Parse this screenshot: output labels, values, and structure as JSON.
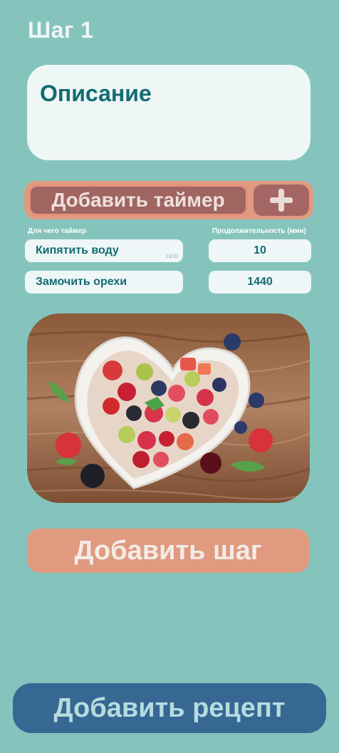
{
  "step": {
    "title": "Шаг 1"
  },
  "description": {
    "label": "Описание"
  },
  "timer": {
    "add_label": "Добавить таймер",
    "plus_icon": "plus-icon",
    "purpose_header": "Для чего таймер",
    "duration_header": "Продолжительность (мин)",
    "rows": [
      {
        "purpose": "Кипятить воду",
        "char_counter": "13/20",
        "duration": "10"
      },
      {
        "purpose": "Замочить орехи",
        "duration": "1440"
      }
    ]
  },
  "photo": {
    "subject": "fruit-and-berry-salad-in-heart-shaped-bowl"
  },
  "actions": {
    "add_step_label": "Добавить шаг",
    "add_recipe_label": "Добавить рецепт"
  },
  "colors": {
    "background": "#85c4bd",
    "card": "#eef6f6",
    "accent_salmon": "#e09a80",
    "timer_button": "#a06461",
    "primary_blue": "#376893",
    "text_teal": "#136b72"
  }
}
